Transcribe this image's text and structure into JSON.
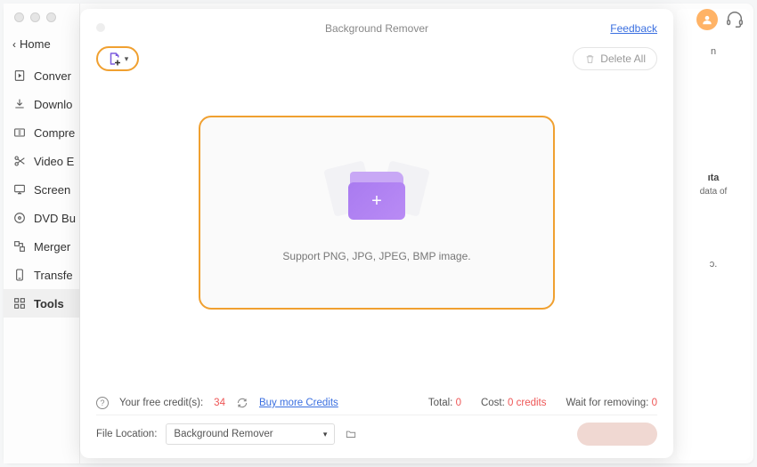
{
  "header": {
    "home": "Home"
  },
  "top": {
    "avatar": "user-avatar",
    "support": "support-headset"
  },
  "sidebar": [
    {
      "icon": "convert",
      "label": "Conver"
    },
    {
      "icon": "download",
      "label": "Downlo"
    },
    {
      "icon": "compress",
      "label": "Compre"
    },
    {
      "icon": "scissors",
      "label": "Video E"
    },
    {
      "icon": "screen",
      "label": "Screen"
    },
    {
      "icon": "disc",
      "label": "DVD Bu"
    },
    {
      "icon": "merge",
      "label": "Merger"
    },
    {
      "icon": "transfer",
      "label": "Transfe"
    },
    {
      "icon": "grid",
      "label": "Tools"
    }
  ],
  "background_fragments": {
    "a": "n",
    "b": "ıta",
    "c": "data of",
    "d": "ɔ."
  },
  "modal": {
    "title": "Background Remover",
    "feedback": "Feedback",
    "delete_all": "Delete All",
    "dropzone_text": "Support PNG, JPG, JPEG, BMP image.",
    "credits": {
      "label": "Your free credit(s):",
      "value": "34",
      "buy": "Buy more Credits",
      "total_label": "Total:",
      "total": "0",
      "cost_label": "Cost:",
      "cost": "0 credits",
      "wait_label": "Wait for removing:",
      "wait": "0"
    },
    "location": {
      "label": "File Location:",
      "value": "Background Remover"
    }
  }
}
